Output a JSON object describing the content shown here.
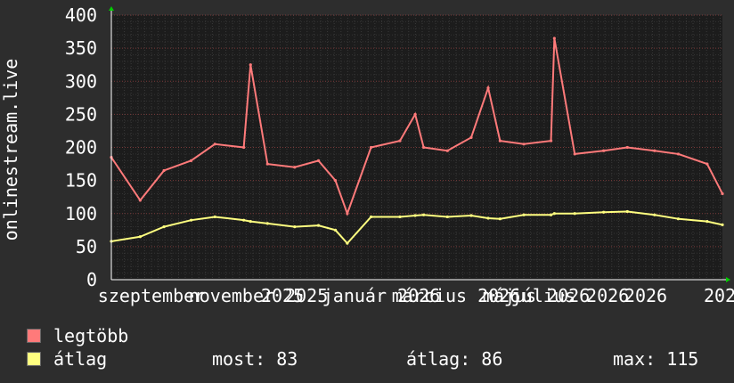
{
  "chart_data": {
    "type": "line",
    "ylabel": "onlinestream.live",
    "ylim": [
      0,
      400
    ],
    "y_ticks": [
      0,
      50,
      100,
      150,
      200,
      250,
      300,
      350,
      400
    ],
    "x_tick_labels": [
      "szeptember",
      "november 2025",
      "2025",
      "január 2026",
      "március 2026",
      "május 2026",
      "július 2026",
      "2026",
      "202"
    ],
    "grid": true,
    "x": [
      "2025-08-15",
      "2025-09-01",
      "2025-09-15",
      "2025-10-01",
      "2025-10-15",
      "2025-11-01",
      "2025-11-05",
      "2025-11-15",
      "2025-12-01",
      "2025-12-15",
      "2025-12-25",
      "2026-01-01",
      "2026-01-15",
      "2026-02-01",
      "2026-02-10",
      "2026-02-15",
      "2026-03-01",
      "2026-03-15",
      "2026-03-25",
      "2026-04-01",
      "2026-04-15",
      "2026-05-01",
      "2026-05-03",
      "2026-05-15",
      "2026-06-01",
      "2026-06-15",
      "2026-07-01",
      "2026-07-15",
      "2026-08-01",
      "2026-08-10"
    ],
    "series": [
      {
        "name": "legtöbb",
        "color": "#ff7a7a",
        "values": [
          185,
          120,
          165,
          180,
          205,
          200,
          325,
          175,
          170,
          180,
          150,
          100,
          200,
          210,
          250,
          200,
          195,
          215,
          290,
          210,
          205,
          210,
          365,
          190,
          195,
          200,
          195,
          190,
          175,
          130
        ]
      },
      {
        "name": "átlag",
        "color": "#ffff80",
        "values": [
          58,
          65,
          80,
          90,
          95,
          90,
          88,
          85,
          80,
          82,
          75,
          55,
          95,
          95,
          97,
          98,
          95,
          97,
          93,
          92,
          98,
          98,
          100,
          100,
          102,
          103,
          98,
          92,
          88,
          83
        ]
      }
    ]
  },
  "legend": {
    "max_label": "legtöbb",
    "avg_label": "átlag",
    "max_color": "#ff7a7a",
    "avg_color": "#ffff80"
  },
  "stats": {
    "now": "most: 83",
    "avg": "átlag: 86",
    "max": "max: 115"
  }
}
